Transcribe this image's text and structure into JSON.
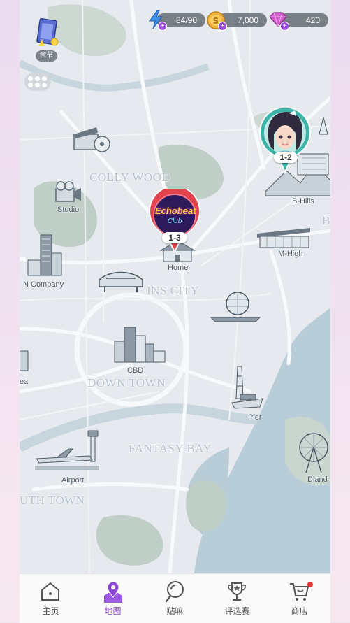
{
  "resources": {
    "energy": "84/90",
    "coins": "7,000",
    "gems": "420"
  },
  "chapter": {
    "label": "章节"
  },
  "districts": {
    "collywood": "COLLY WOOD",
    "ins_city": "INS CITY",
    "downtown": "DOWN TOWN",
    "fantasy_bay": "FANTASY BAY",
    "south_town": "UTH TOWN"
  },
  "places": {
    "studio": "Studio",
    "b_hills": "B-Hills",
    "home": "Home",
    "m_high": "M-High",
    "n_company": "N Company",
    "cbd": "CBD",
    "pier": "Pier",
    "airport": "Airport",
    "dland": "Dland",
    "ea": "ea",
    "b_edge": "B"
  },
  "pins": {
    "echobeat": {
      "title": "Echobeat",
      "subtitle": "Club",
      "stage": "1-3"
    },
    "character": {
      "stage": "1-2"
    }
  },
  "nav": {
    "items": [
      {
        "label": "主页",
        "icon": "home-icon"
      },
      {
        "label": "地图",
        "icon": "map-pin-icon"
      },
      {
        "label": "贴嘛",
        "icon": "post-icon"
      },
      {
        "label": "评选赛",
        "icon": "trophy-icon"
      },
      {
        "label": "商店",
        "icon": "cart-icon"
      }
    ],
    "active_index": 1
  },
  "colors": {
    "accent": "#8e4ad6",
    "water": "#b7cbd6",
    "park": "#bfcdc6",
    "land": "#e6eaee",
    "pin_red": "#e0434c",
    "pin_teal": "#3bb3a8"
  }
}
